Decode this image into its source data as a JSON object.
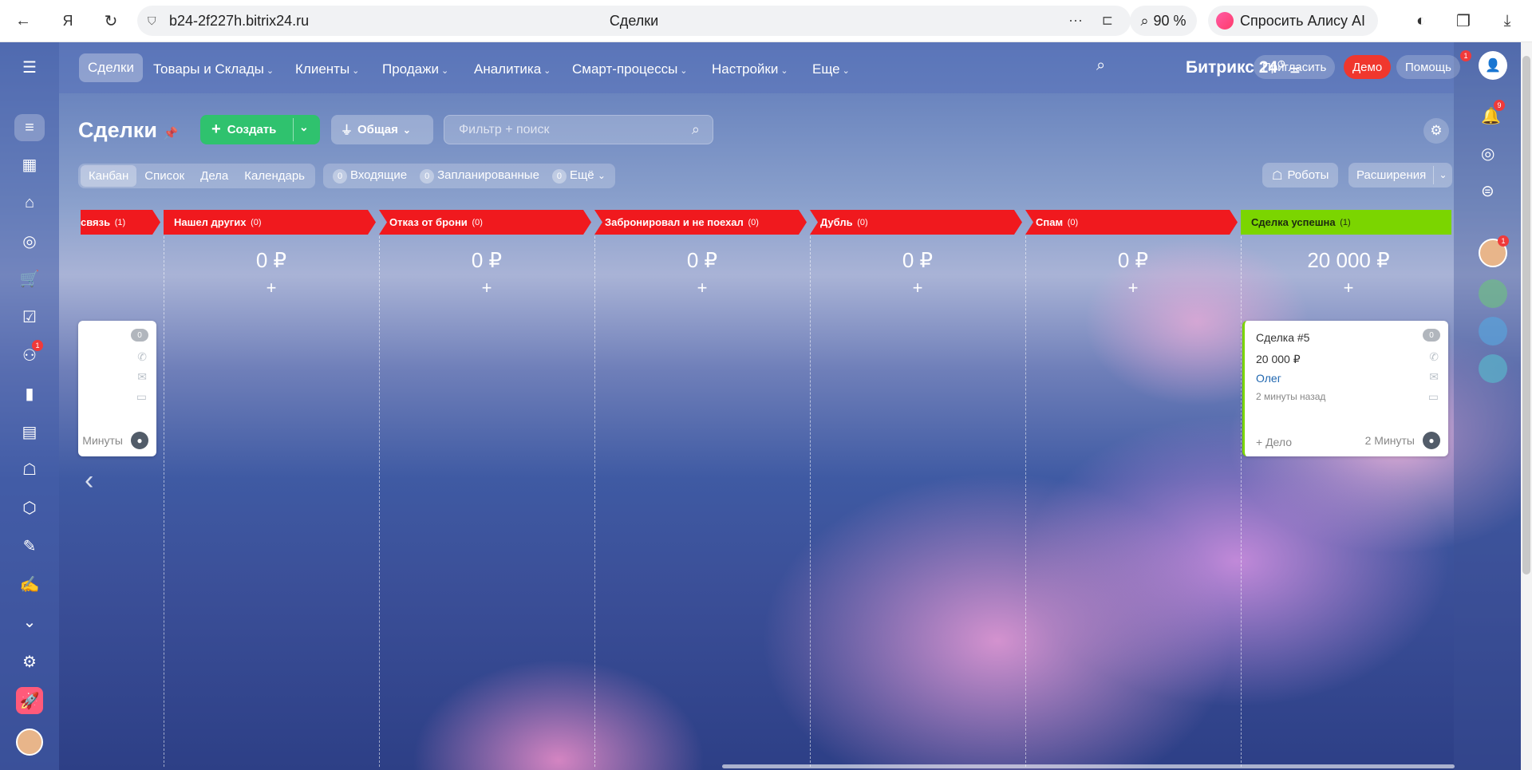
{
  "browser": {
    "url": "b24-2f227h.bitrix24.ru",
    "tab_title": "Сделки",
    "zoom": "90 %",
    "alice_label": "Спросить Алису AI"
  },
  "topmenu": {
    "items": [
      {
        "label": "Сделки",
        "active": true
      },
      {
        "label": "Товары и Склады"
      },
      {
        "label": "Клиенты"
      },
      {
        "label": "Продажи"
      },
      {
        "label": "Аналитика"
      },
      {
        "label": "Смарт-процессы"
      },
      {
        "label": "Настройки"
      },
      {
        "label": "Еще"
      }
    ],
    "brand": "Битрикс 24",
    "invite": "Пригласить",
    "demo": "Демо",
    "help": "Помощь",
    "help_badge": "1"
  },
  "toolbar": {
    "title": "Сделки",
    "create": "Создать",
    "category": "Общая",
    "search_placeholder": "Фильтр + поиск",
    "views": [
      "Канбан",
      "Список",
      "Дела",
      "Календарь"
    ],
    "counters": [
      {
        "count": "0",
        "label": "Входящие"
      },
      {
        "count": "0",
        "label": "Запланированные"
      },
      {
        "count": "0",
        "label": "Ещё"
      }
    ],
    "robots": "Роботы",
    "extensions": "Расширения"
  },
  "leftbar": {
    "badge_count": "1"
  },
  "rightbar": {
    "notifications_badge": "9",
    "avatar_badge": "1"
  },
  "kanban": {
    "columns": [
      {
        "name": "связь",
        "count": "(1)",
        "sum": "",
        "color": "#f0191e"
      },
      {
        "name": "Нашел других",
        "count": "(0)",
        "sum": "0 ₽",
        "color": "#f0191e"
      },
      {
        "name": "Отказ от брони",
        "count": "(0)",
        "sum": "0 ₽",
        "color": "#f0191e"
      },
      {
        "name": "Забронировал и не поехал",
        "count": "(0)",
        "sum": "0 ₽",
        "color": "#f0191e"
      },
      {
        "name": "Дубль",
        "count": "(0)",
        "sum": "0 ₽",
        "color": "#f0191e"
      },
      {
        "name": "Спам",
        "count": "(0)",
        "sum": "0 ₽",
        "color": "#f0191e"
      },
      {
        "name": "Сделка успешна",
        "count": "(1)",
        "sum": "20 000 ₽",
        "color": "#7bd500"
      }
    ],
    "left_card": {
      "zero": "0",
      "duration": "Минуты"
    },
    "deal_card": {
      "title": "Сделка #5",
      "amount": "20 000 ₽",
      "client": "Олег",
      "time_ago": "2 минуты назад",
      "add_deal": "+ Дело",
      "duration": "2 Минуты",
      "zero": "0"
    }
  }
}
